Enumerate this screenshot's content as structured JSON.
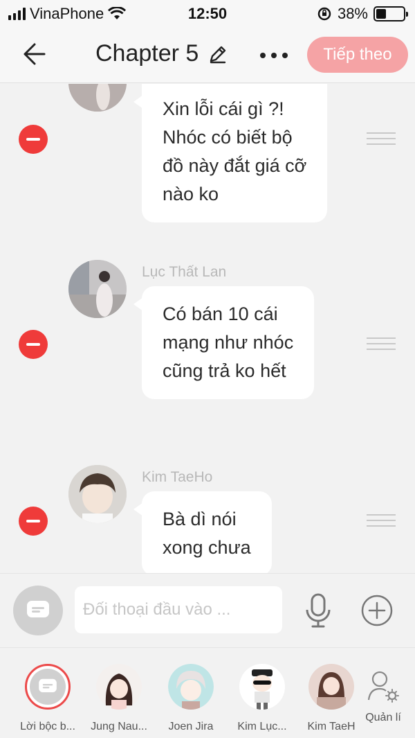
{
  "status_bar": {
    "carrier": "VinaPhone",
    "time": "12:50",
    "battery": "38%",
    "battery_level": 0.38
  },
  "header": {
    "title": "Chapter 5",
    "next_label": "Tiếp theo"
  },
  "messages": [
    {
      "sender": "",
      "lines": [
        "Xin lỗi cái gì ?!",
        "Nhóc có biết bộ",
        "đồ này đắt giá cỡ",
        "nào ko"
      ]
    },
    {
      "sender": "Lục Thất Lan",
      "lines": [
        "Có bán 10 cái",
        "mạng như nhóc",
        "cũng trả ko hết"
      ]
    },
    {
      "sender": "Kim TaeHo",
      "lines": [
        "Bà dì nói",
        "xong chưa"
      ]
    }
  ],
  "input": {
    "placeholder": "Đối thoại đầu vào ..."
  },
  "characters": [
    {
      "name": "Lời bộc b..."
    },
    {
      "name": "Jung Nau..."
    },
    {
      "name": "Joen Jira"
    },
    {
      "name": "Kim Lục..."
    },
    {
      "name": "Kim TaeH"
    }
  ],
  "manage_label": "Quản lí",
  "colors": {
    "accent": "#f5a3a5",
    "delete": "#ef3b3a",
    "selected_ring": "#ec4a4a"
  }
}
